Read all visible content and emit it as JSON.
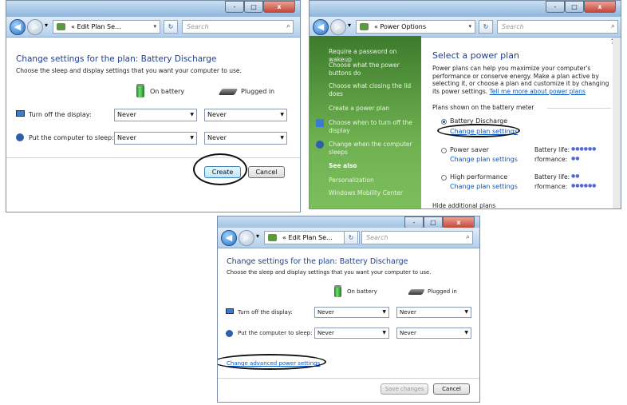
{
  "window1": {
    "caption": {
      "minimize": "-",
      "maximize": "□",
      "close": "x"
    },
    "nav": {
      "back": "◀",
      "forward": "▶",
      "dropdown": "▾"
    },
    "breadcrumb": "« Edit Plan Se...",
    "refresh": "↻",
    "search_placeholder": "Search",
    "title": "Change settings for the plan: Battery Discharge",
    "subtitle": "Choose the sleep and display settings that you want your computer to use.",
    "on_battery_label": "On battery",
    "plugged_in_label": "Plugged in",
    "display_label": "Turn off the display:",
    "sleep_label": "Put the computer to sleep:",
    "display_battery": "Never",
    "display_plugged": "Never",
    "sleep_battery": "Never",
    "sleep_plugged": "Never",
    "create_button": "Create",
    "cancel_button": "Cancel"
  },
  "window2": {
    "caption": {
      "minimize": "-",
      "maximize": "□",
      "close": "x"
    },
    "nav": {
      "back": "◀",
      "forward": "▶",
      "dropdown": "▾"
    },
    "breadcrumb": "« Power Options",
    "refresh": "↻",
    "search_placeholder": "Search",
    "help": "?",
    "sidebar": {
      "items": [
        "Require a password on wakeup",
        "Choose what the power buttons do",
        "Choose what closing the lid does",
        "Create a power plan",
        "Choose when to turn off the display",
        "Change when the computer sleeps"
      ],
      "see_also": "See also",
      "see_also_items": [
        "Personalization",
        "Windows Mobility Center"
      ]
    },
    "title": "Select a power plan",
    "description": "Power plans can help you maximize your computer's performance or conserve energy. Make a plan active by selecting it, or choose a plan and customize it by changing its power settings.",
    "learn_more_link": "Tell me more about power plans",
    "plans_header": "Plans shown on the battery meter",
    "plans": [
      {
        "name": "Battery Discharge",
        "link": "Change plan settings",
        "selected": true
      },
      {
        "name": "Power saver",
        "link": "Change plan settings",
        "selected": false,
        "battery_life_label": "Battery life:",
        "battery_life": "●●●●●●",
        "performance_label": "rformance:",
        "performance": "●●"
      },
      {
        "name": "High performance",
        "link": "Change plan settings",
        "selected": false,
        "battery_life_label": "Battery life:",
        "battery_life": "●●",
        "performance_label": "rformance:",
        "performance": "●●●●●●"
      }
    ],
    "hide_additional": "Hide additional plans"
  },
  "window3": {
    "caption": {
      "minimize": "-",
      "maximize": "□",
      "close": "x"
    },
    "nav": {
      "back": "◀",
      "forward": "▶",
      "dropdown": "▾"
    },
    "breadcrumb": "« Edit Plan Se...",
    "refresh": "↻",
    "search_placeholder": "Search",
    "title": "Change settings for the plan: Battery Discharge",
    "subtitle": "Choose the sleep and display settings that you want your computer to use.",
    "on_battery_label": "On battery",
    "plugged_in_label": "Plugged in",
    "display_label": "Turn off the display:",
    "sleep_label": "Put the computer to sleep:",
    "display_battery": "Never",
    "display_plugged": "Never",
    "sleep_battery": "Never",
    "sleep_plugged": "Never",
    "advanced_link": "Change advanced power settings",
    "save_button": "Save changes",
    "cancel_button": "Cancel"
  },
  "colors": {
    "title_blue": "#1c3f94",
    "link_blue": "#0a58c6",
    "sidebar_green": "#5a9e42"
  }
}
